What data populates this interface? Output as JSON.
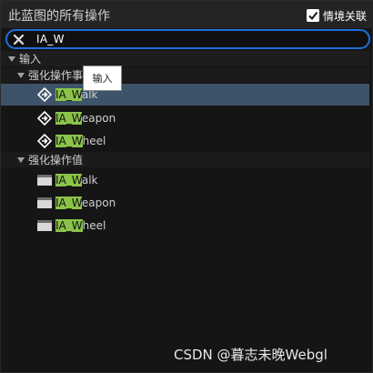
{
  "header": {
    "title": "此蓝图的所有操作",
    "context_label": "情境关联",
    "context_checked": true
  },
  "search": {
    "value": "IA_W"
  },
  "tree": {
    "root_label": "输入",
    "tooltip": "输入",
    "events": {
      "label": "强化操作事",
      "items": [
        {
          "hl": "IA_W",
          "rest": "alk"
        },
        {
          "hl": "IA_W",
          "rest": "eapon"
        },
        {
          "hl": "IA_W",
          "rest": "heel"
        }
      ]
    },
    "values": {
      "label": "强化操作值",
      "items": [
        {
          "hl": "IA_W",
          "rest": "alk"
        },
        {
          "hl": "IA_W",
          "rest": "eapon"
        },
        {
          "hl": "IA_W",
          "rest": "heel"
        }
      ]
    }
  },
  "watermark": "CSDN @暮志未晚Webgl",
  "colors": {
    "accent": "#1f6ed8",
    "highlight": "#8bc34a",
    "selected": "#3d5369"
  }
}
